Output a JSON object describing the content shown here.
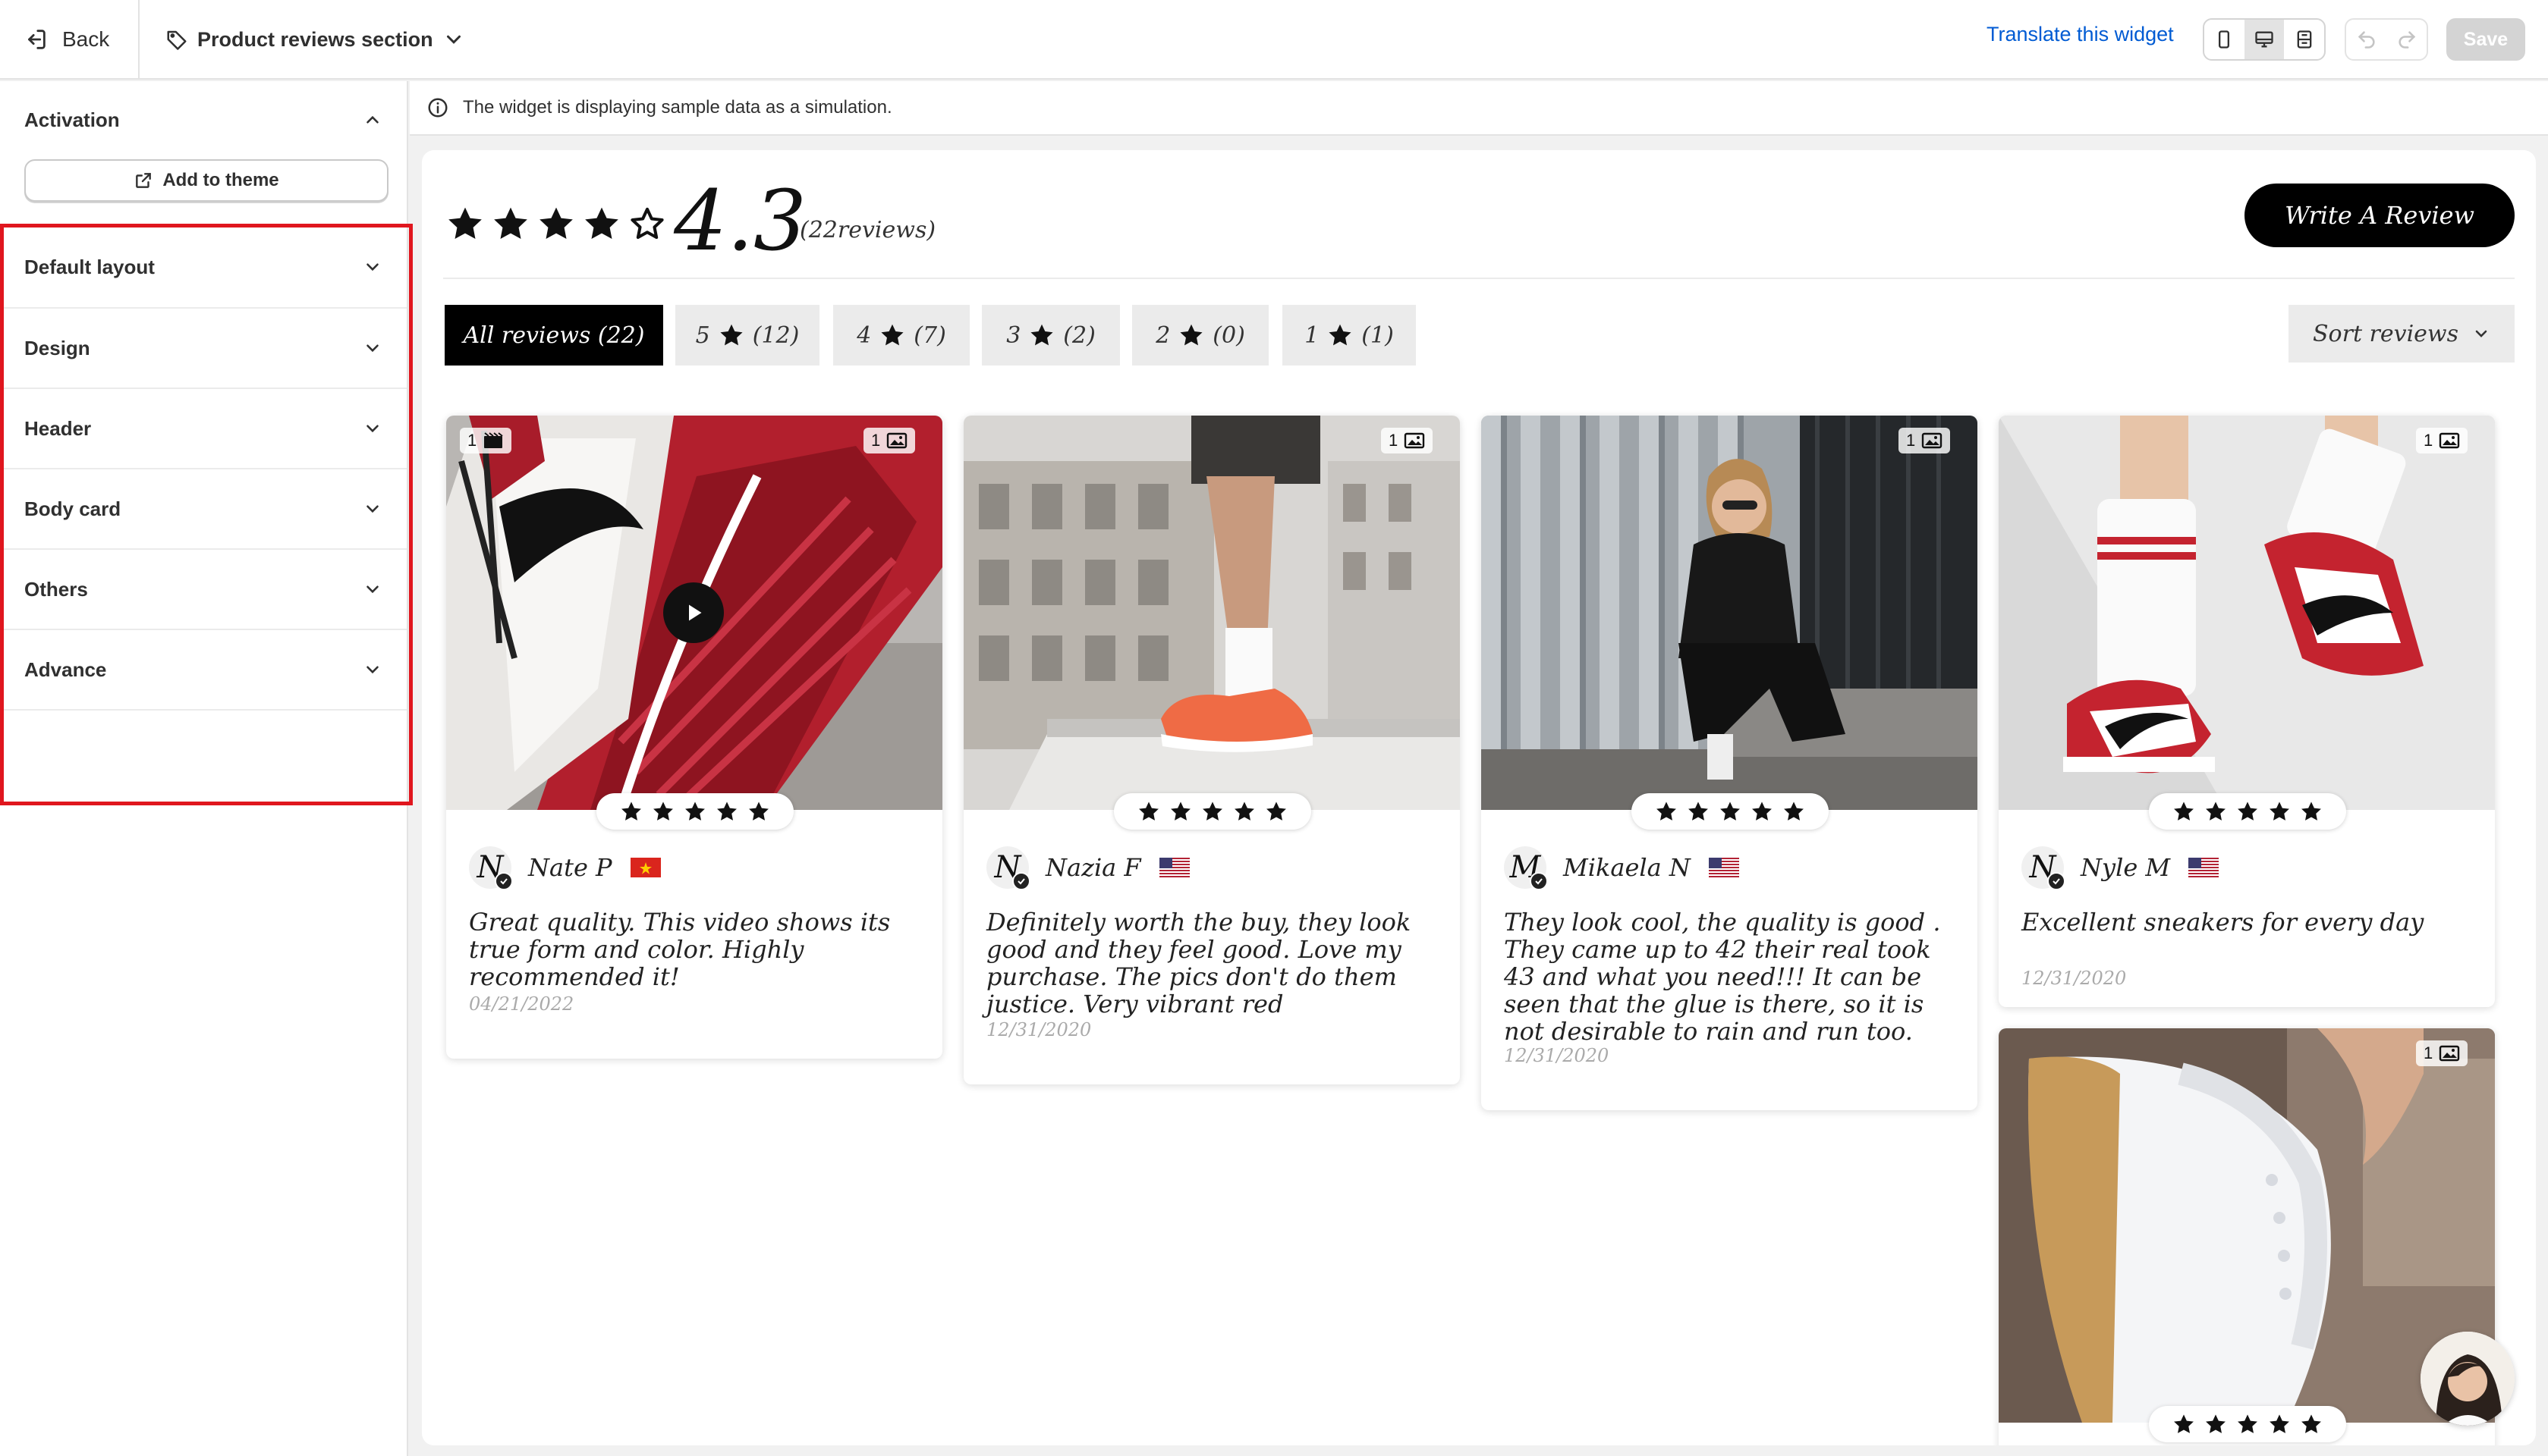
{
  "topbar": {
    "back_label": "Back",
    "section_name": "Product reviews section",
    "translate_label": "Translate this widget",
    "save_label": "Save",
    "device_modes": [
      "mobile",
      "desktop",
      "fullscreen"
    ],
    "active_device": "desktop"
  },
  "sidebar": {
    "activation_label": "Activation",
    "add_to_theme_label": "Add to theme",
    "sections": [
      "Default layout",
      "Design",
      "Header",
      "Body card",
      "Others",
      "Advance"
    ],
    "highlight_color": "#e0161e"
  },
  "info_bar": {
    "message": "The widget is displaying sample data as a simulation."
  },
  "widget": {
    "rating": "4.3",
    "rating_stars": 4,
    "review_count_label": "(22reviews)",
    "write_review_label": "Write A Review",
    "sort_label": "Sort reviews",
    "filters": {
      "all": "All reviews (22)",
      "five": {
        "num": "5",
        "count": "(12)"
      },
      "four": {
        "num": "4",
        "count": "(7)"
      },
      "three": {
        "num": "3",
        "count": "(2)"
      },
      "two": {
        "num": "2",
        "count": "(0)"
      },
      "one": {
        "num": "1",
        "count": "(1)"
      }
    },
    "reviews": [
      {
        "initial": "N",
        "name": "Nate P",
        "flag": "vietnam-flag-icon",
        "text": "Great quality. This video shows its true form and color. Highly recommended it!",
        "date": "04/21/2022",
        "media_count": "1",
        "media_type": "video",
        "stars": 5
      },
      {
        "initial": "N",
        "name": "Nazia F",
        "flag": "usa-flag-icon",
        "text": "Definitely worth the buy, they look good and they feel good. Love my purchase. The pics don't do them justice. Very vibrant red",
        "date": "12/31/2020",
        "media_count": "1",
        "media_type": "image",
        "stars": 5
      },
      {
        "initial": "M",
        "name": "Mikaela N",
        "flag": "usa-flag-icon",
        "text": "They look cool, the quality is good . They came up to 42 their real took 43 and what you need!!! It can be seen that the glue is there, so it is not desirable to rain and run too.",
        "date": "12/31/2020",
        "media_count": "1",
        "media_type": "image",
        "stars": 5
      },
      {
        "initial": "N",
        "name": "Nyle M",
        "flag": "usa-flag-icon",
        "text": "Excellent sneakers for every day",
        "date": "12/31/2020",
        "media_count": "1",
        "media_type": "image",
        "stars": 5
      },
      {
        "media_count": "1",
        "media_type": "image",
        "stars": 5
      }
    ]
  }
}
